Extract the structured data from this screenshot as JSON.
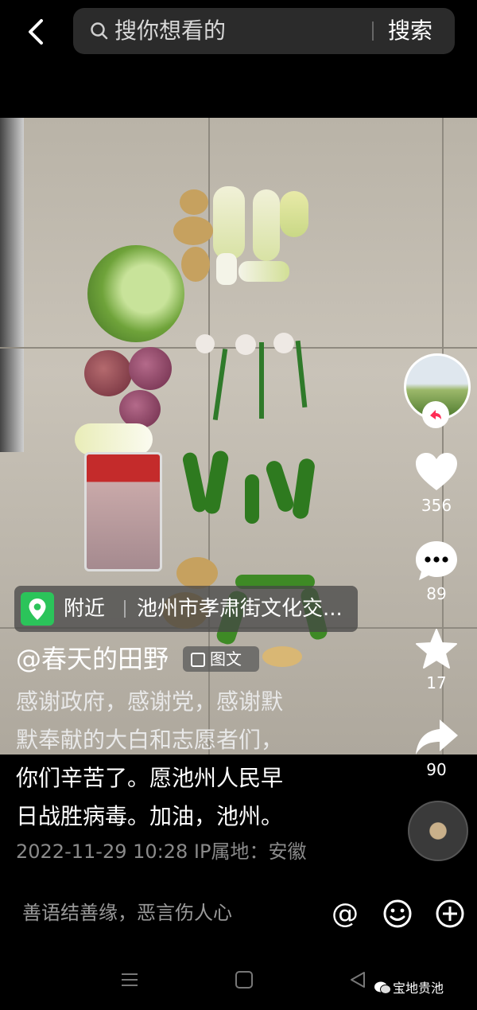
{
  "search": {
    "placeholder": "搜你想看的",
    "button_label": "搜索"
  },
  "post": {
    "location": {
      "near_label": "附近",
      "address": "池州市孝肃街文化交..."
    },
    "author": "@春天的田野",
    "type_tag": "图文",
    "caption_lines": [
      "感谢政府，感谢党，感谢默",
      "默奉献的大白和志愿者们，",
      "你们辛苦了。愿池州人民早",
      "日战胜病毒。加油，池州。"
    ],
    "meta": "2022-11-29 10:28  IP属地：安徽"
  },
  "actions": {
    "likes": "356",
    "comments": "89",
    "favorites": "17",
    "shares": "90"
  },
  "comment_bar": {
    "placeholder": "善语结善缘，恶言伤人心"
  },
  "watermark": "宝地贵池",
  "colors": {
    "accent_red": "#fe2c55",
    "location_green": "#2bc45a"
  },
  "icons": [
    "back-icon",
    "search-icon",
    "heart-icon",
    "comment-icon",
    "star-icon",
    "share-icon",
    "at-icon",
    "emoji-icon",
    "plus-icon",
    "menu-icon",
    "home-icon",
    "back-triangle-icon"
  ]
}
